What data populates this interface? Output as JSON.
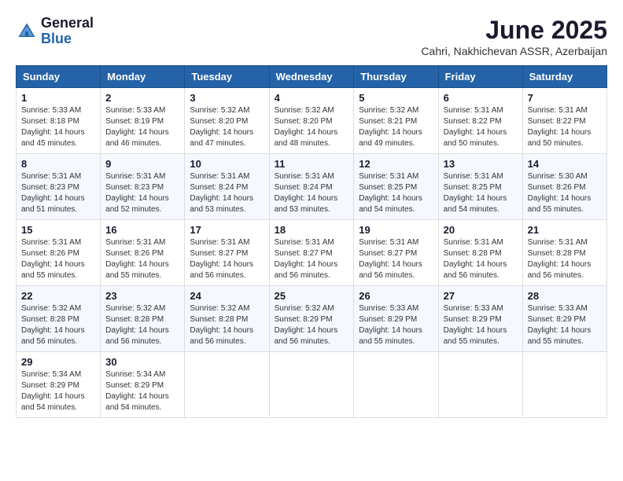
{
  "header": {
    "logo_line1": "General",
    "logo_line2": "Blue",
    "month": "June 2025",
    "location": "Cahri, Nakhichevan ASSR, Azerbaijan"
  },
  "weekdays": [
    "Sunday",
    "Monday",
    "Tuesday",
    "Wednesday",
    "Thursday",
    "Friday",
    "Saturday"
  ],
  "weeks": [
    [
      {
        "day": "1",
        "sunrise": "5:33 AM",
        "sunset": "8:18 PM",
        "daylight": "14 hours and 45 minutes."
      },
      {
        "day": "2",
        "sunrise": "5:33 AM",
        "sunset": "8:19 PM",
        "daylight": "14 hours and 46 minutes."
      },
      {
        "day": "3",
        "sunrise": "5:32 AM",
        "sunset": "8:20 PM",
        "daylight": "14 hours and 47 minutes."
      },
      {
        "day": "4",
        "sunrise": "5:32 AM",
        "sunset": "8:20 PM",
        "daylight": "14 hours and 48 minutes."
      },
      {
        "day": "5",
        "sunrise": "5:32 AM",
        "sunset": "8:21 PM",
        "daylight": "14 hours and 49 minutes."
      },
      {
        "day": "6",
        "sunrise": "5:31 AM",
        "sunset": "8:22 PM",
        "daylight": "14 hours and 50 minutes."
      },
      {
        "day": "7",
        "sunrise": "5:31 AM",
        "sunset": "8:22 PM",
        "daylight": "14 hours and 50 minutes."
      }
    ],
    [
      {
        "day": "8",
        "sunrise": "5:31 AM",
        "sunset": "8:23 PM",
        "daylight": "14 hours and 51 minutes."
      },
      {
        "day": "9",
        "sunrise": "5:31 AM",
        "sunset": "8:23 PM",
        "daylight": "14 hours and 52 minutes."
      },
      {
        "day": "10",
        "sunrise": "5:31 AM",
        "sunset": "8:24 PM",
        "daylight": "14 hours and 53 minutes."
      },
      {
        "day": "11",
        "sunrise": "5:31 AM",
        "sunset": "8:24 PM",
        "daylight": "14 hours and 53 minutes."
      },
      {
        "day": "12",
        "sunrise": "5:31 AM",
        "sunset": "8:25 PM",
        "daylight": "14 hours and 54 minutes."
      },
      {
        "day": "13",
        "sunrise": "5:31 AM",
        "sunset": "8:25 PM",
        "daylight": "14 hours and 54 minutes."
      },
      {
        "day": "14",
        "sunrise": "5:30 AM",
        "sunset": "8:26 PM",
        "daylight": "14 hours and 55 minutes."
      }
    ],
    [
      {
        "day": "15",
        "sunrise": "5:31 AM",
        "sunset": "8:26 PM",
        "daylight": "14 hours and 55 minutes."
      },
      {
        "day": "16",
        "sunrise": "5:31 AM",
        "sunset": "8:26 PM",
        "daylight": "14 hours and 55 minutes."
      },
      {
        "day": "17",
        "sunrise": "5:31 AM",
        "sunset": "8:27 PM",
        "daylight": "14 hours and 56 minutes."
      },
      {
        "day": "18",
        "sunrise": "5:31 AM",
        "sunset": "8:27 PM",
        "daylight": "14 hours and 56 minutes."
      },
      {
        "day": "19",
        "sunrise": "5:31 AM",
        "sunset": "8:27 PM",
        "daylight": "14 hours and 56 minutes."
      },
      {
        "day": "20",
        "sunrise": "5:31 AM",
        "sunset": "8:28 PM",
        "daylight": "14 hours and 56 minutes."
      },
      {
        "day": "21",
        "sunrise": "5:31 AM",
        "sunset": "8:28 PM",
        "daylight": "14 hours and 56 minutes."
      }
    ],
    [
      {
        "day": "22",
        "sunrise": "5:32 AM",
        "sunset": "8:28 PM",
        "daylight": "14 hours and 56 minutes."
      },
      {
        "day": "23",
        "sunrise": "5:32 AM",
        "sunset": "8:28 PM",
        "daylight": "14 hours and 56 minutes."
      },
      {
        "day": "24",
        "sunrise": "5:32 AM",
        "sunset": "8:28 PM",
        "daylight": "14 hours and 56 minutes."
      },
      {
        "day": "25",
        "sunrise": "5:32 AM",
        "sunset": "8:29 PM",
        "daylight": "14 hours and 56 minutes."
      },
      {
        "day": "26",
        "sunrise": "5:33 AM",
        "sunset": "8:29 PM",
        "daylight": "14 hours and 55 minutes."
      },
      {
        "day": "27",
        "sunrise": "5:33 AM",
        "sunset": "8:29 PM",
        "daylight": "14 hours and 55 minutes."
      },
      {
        "day": "28",
        "sunrise": "5:33 AM",
        "sunset": "8:29 PM",
        "daylight": "14 hours and 55 minutes."
      }
    ],
    [
      {
        "day": "29",
        "sunrise": "5:34 AM",
        "sunset": "8:29 PM",
        "daylight": "14 hours and 54 minutes."
      },
      {
        "day": "30",
        "sunrise": "5:34 AM",
        "sunset": "8:29 PM",
        "daylight": "14 hours and 54 minutes."
      },
      null,
      null,
      null,
      null,
      null
    ]
  ]
}
